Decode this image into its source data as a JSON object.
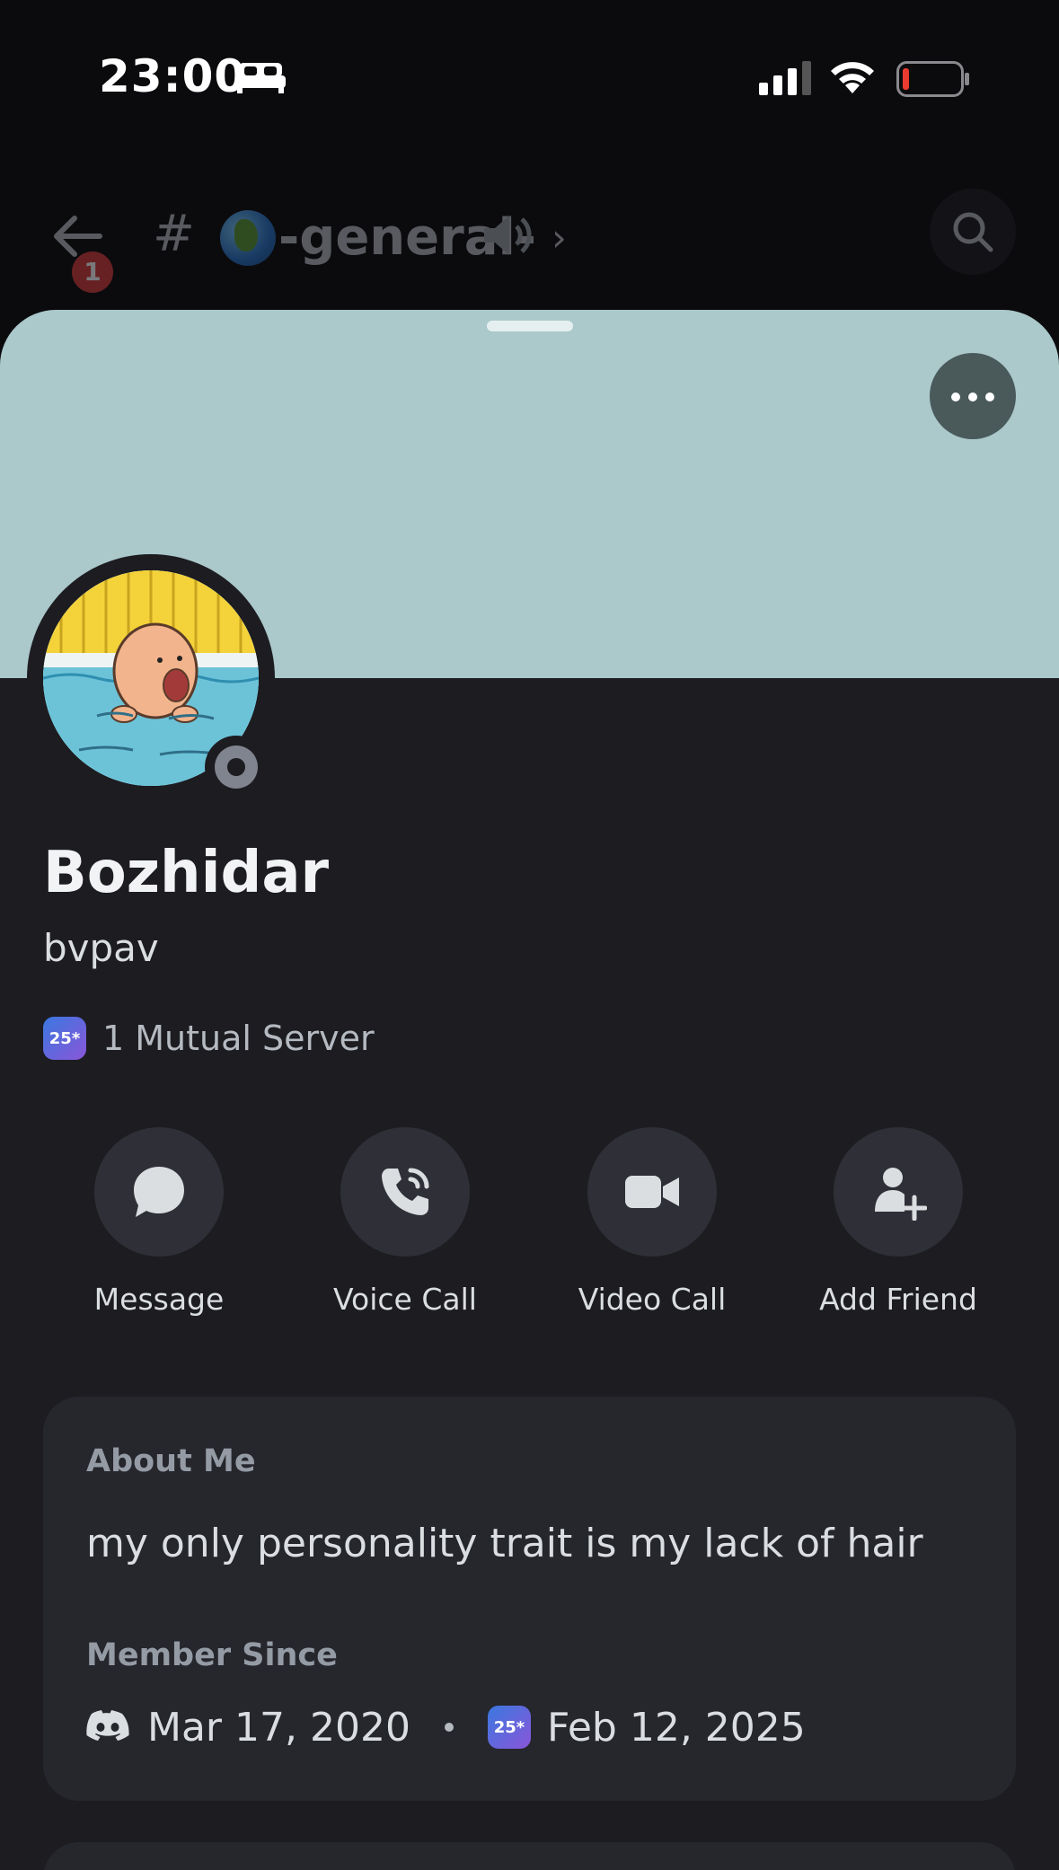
{
  "status_bar": {
    "time": "23:00"
  },
  "channel_header": {
    "unread_count": "1",
    "hash": "#",
    "channel_name": "-general-"
  },
  "profile": {
    "display_name": "Bozhidar",
    "username": "bvpav",
    "mutual_servers": "1 Mutual Server",
    "server_icon_text": "25*",
    "status": "offline"
  },
  "actions": [
    {
      "label": "Message",
      "icon": "chat-bubble-icon"
    },
    {
      "label": "Voice Call",
      "icon": "phone-icon"
    },
    {
      "label": "Video Call",
      "icon": "video-camera-icon"
    },
    {
      "label": "Add Friend",
      "icon": "add-friend-icon"
    }
  ],
  "about": {
    "heading": "About Me",
    "text": "my only personality trait is my lack of hair"
  },
  "member_since": {
    "heading": "Member Since",
    "discord_date": "Mar 17, 2020",
    "server_date": "Feb 12, 2025",
    "server_icon_text": "25*"
  },
  "colors": {
    "banner": "#abc8ca",
    "sheet_bg": "#1c1c21",
    "card_bg": "#26262d",
    "badge_red": "#d83c3e"
  }
}
